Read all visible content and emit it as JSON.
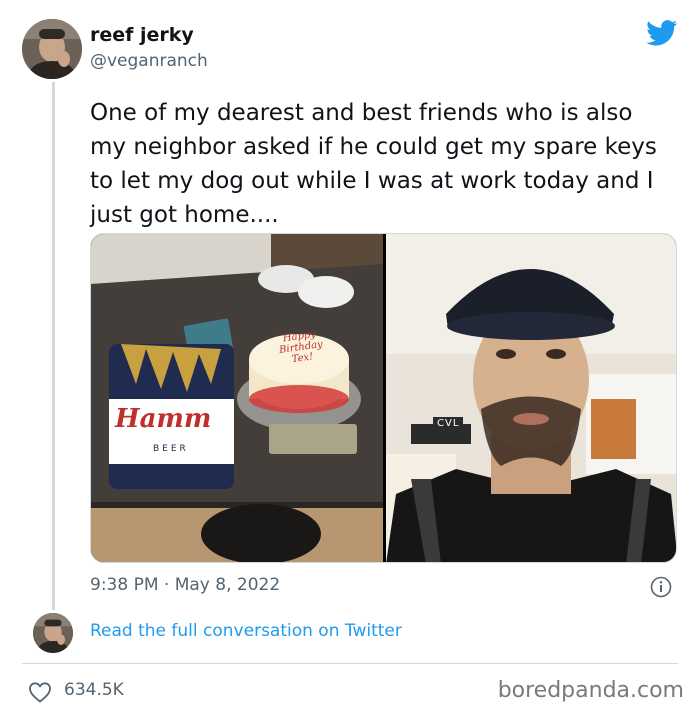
{
  "author": {
    "name": "reef jerky",
    "handle": "@veganranch"
  },
  "tweet": {
    "text": "One of my dearest and best friends who is also my neighbor asked if he could get my spare keys to let my dog out while I was at work today and I just got home....",
    "timestamp": "9:38 PM · May 8, 2022"
  },
  "media": {
    "photo_left": {
      "cake_text": [
        "Happy",
        "Birthday",
        "Tex!"
      ],
      "shirt_brand": "Hamm",
      "shirt_sub": "BEER"
    },
    "photo_right": {
      "sign_text": "CVL"
    }
  },
  "thread": {
    "read_more": "Read the full conversation on Twitter"
  },
  "stats": {
    "likes": "634.5K"
  },
  "watermark": "boredpanda.com",
  "colors": {
    "link": "#1d9bf0",
    "muted": "#536471",
    "text": "#0f1419",
    "twitter_bird": "#1d9bf0"
  },
  "icons": {
    "brand": "twitter-bird-icon",
    "info": "info-icon",
    "like": "heart-icon"
  }
}
